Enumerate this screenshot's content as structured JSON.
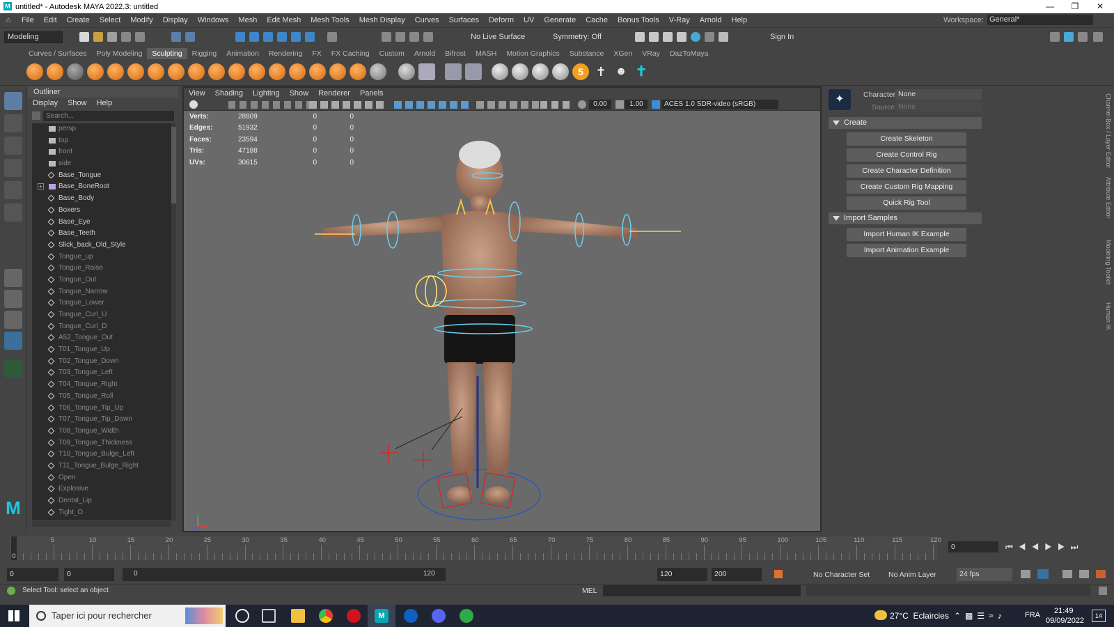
{
  "window": {
    "title": "untitled* - Autodesk MAYA 2022.3: untitled"
  },
  "menubar": [
    "File",
    "Edit",
    "Create",
    "Select",
    "Modify",
    "Display",
    "Windows",
    "Mesh",
    "Edit Mesh",
    "Mesh Tools",
    "Mesh Display",
    "Curves",
    "Surfaces",
    "Deform",
    "UV",
    "Generate",
    "Cache",
    "Bonus Tools",
    "V-Ray",
    "Arnold",
    "Help"
  ],
  "workspace": {
    "label": "Workspace:",
    "value": "General*"
  },
  "statusline": {
    "mode": "Modeling",
    "live_surface": "No Live Surface",
    "symmetry": "Symmetry: Off",
    "sign_in": "Sign In"
  },
  "shelf_tabs": [
    "Curves / Surfaces",
    "Poly Modeling",
    "Sculpting",
    "Rigging",
    "Animation",
    "Rendering",
    "FX",
    "FX Caching",
    "Custom",
    "Arnold",
    "Bifrost",
    "MASH",
    "Motion Graphics",
    "Substance",
    "XGen",
    "VRay",
    "DazToMaya"
  ],
  "shelf_active": "Sculpting",
  "outliner": {
    "title": "Outliner",
    "menu": [
      "Display",
      "Show",
      "Help"
    ],
    "search_placeholder": "Search...",
    "items": [
      {
        "name": "persp",
        "type": "camera",
        "dim": true
      },
      {
        "name": "top",
        "type": "camera",
        "dim": true
      },
      {
        "name": "front",
        "type": "camera",
        "dim": true
      },
      {
        "name": "side",
        "type": "camera",
        "dim": true
      },
      {
        "name": "Base_Tongue",
        "type": "mesh",
        "dim": false
      },
      {
        "name": "Base_BoneRoot",
        "type": "joint",
        "dim": false,
        "expandable": true
      },
      {
        "name": "Base_Body",
        "type": "mesh",
        "dim": false
      },
      {
        "name": "Boxers",
        "type": "mesh",
        "dim": false
      },
      {
        "name": "Base_Eye",
        "type": "mesh",
        "dim": false
      },
      {
        "name": "Base_Teeth",
        "type": "mesh",
        "dim": false
      },
      {
        "name": "Slick_back_Old_Style",
        "type": "mesh",
        "dim": false
      },
      {
        "name": "Tongue_up",
        "type": "mesh",
        "dim": true
      },
      {
        "name": "Tongue_Raise",
        "type": "mesh",
        "dim": true
      },
      {
        "name": "Tongue_Out",
        "type": "mesh",
        "dim": true
      },
      {
        "name": "Tongue_Narrow",
        "type": "mesh",
        "dim": true
      },
      {
        "name": "Tongue_Lower",
        "type": "mesh",
        "dim": true
      },
      {
        "name": "Tongue_Curl_U",
        "type": "mesh",
        "dim": true
      },
      {
        "name": "Tongue_Curl_D",
        "type": "mesh",
        "dim": true
      },
      {
        "name": "A52_Tongue_Out",
        "type": "mesh",
        "dim": true
      },
      {
        "name": "T01_Tongue_Up",
        "type": "mesh",
        "dim": true
      },
      {
        "name": "T02_Tongue_Down",
        "type": "mesh",
        "dim": true
      },
      {
        "name": "T03_Tongue_Left",
        "type": "mesh",
        "dim": true
      },
      {
        "name": "T04_Tongue_Right",
        "type": "mesh",
        "dim": true
      },
      {
        "name": "T05_Tongue_Roll",
        "type": "mesh",
        "dim": true
      },
      {
        "name": "T06_Tongue_Tip_Up",
        "type": "mesh",
        "dim": true
      },
      {
        "name": "T07_Tongue_Tip_Down",
        "type": "mesh",
        "dim": true
      },
      {
        "name": "T08_Tongue_Width",
        "type": "mesh",
        "dim": true
      },
      {
        "name": "T09_Tongue_Thickness",
        "type": "mesh",
        "dim": true
      },
      {
        "name": "T10_Tongue_Bulge_Left",
        "type": "mesh",
        "dim": true
      },
      {
        "name": "T11_Tongue_Bulge_Right",
        "type": "mesh",
        "dim": true
      },
      {
        "name": "Open",
        "type": "mesh",
        "dim": true
      },
      {
        "name": "Explosive",
        "type": "mesh",
        "dim": true
      },
      {
        "name": "Dental_Lip",
        "type": "mesh",
        "dim": true
      },
      {
        "name": "Tight_O",
        "type": "mesh",
        "dim": true
      }
    ]
  },
  "viewport": {
    "menu": [
      "View",
      "Shading",
      "Lighting",
      "Show",
      "Renderer",
      "Panels"
    ],
    "exposure": "0.00",
    "gamma": "1.00",
    "colorspace": "ACES 1.0 SDR-video (sRGB)",
    "hud": [
      {
        "label": "Verts:",
        "v": "28809",
        "a": "0",
        "b": "0"
      },
      {
        "label": "Edges:",
        "v": "51932",
        "a": "0",
        "b": "0"
      },
      {
        "label": "Faces:",
        "v": "23594",
        "a": "0",
        "b": "0"
      },
      {
        "label": "Tris:",
        "v": "47188",
        "a": "0",
        "b": "0"
      },
      {
        "label": "UVs:",
        "v": "30615",
        "a": "0",
        "b": "0"
      }
    ]
  },
  "humanik": {
    "character_label": "Character:",
    "character_value": "None",
    "source_label": "Source:",
    "source_value": "None",
    "create_section": "Create",
    "create_buttons": [
      "Create Skeleton",
      "Create Control Rig",
      "Create Character Definition",
      "Create Custom Rig Mapping",
      "Quick Rig Tool"
    ],
    "import_section": "Import Samples",
    "import_buttons": [
      "Import Human IK Example",
      "Import Animation Example"
    ]
  },
  "side_tabs": [
    "Channel Box / Layer Editor",
    "Attribute Editor",
    "Modeling Toolkit",
    "Human IK"
  ],
  "timeline": {
    "ticks": [
      "5",
      "10",
      "15",
      "20",
      "25",
      "30",
      "35",
      "40",
      "45",
      "50",
      "55",
      "60",
      "65",
      "70",
      "75",
      "80",
      "85",
      "90",
      "95",
      "100",
      "105",
      "110",
      "115",
      "120"
    ],
    "start": "0",
    "current_frame": "0"
  },
  "range": {
    "start": "0",
    "anim_start": "0",
    "slider_start": "0",
    "slider_end": "120",
    "end": "120",
    "anim_end": "200",
    "character_set": "No Character Set",
    "anim_layer": "No Anim Layer",
    "fps": "24 fps"
  },
  "helpline": {
    "text": "Select Tool: select an object",
    "mel": "MEL"
  },
  "taskbar": {
    "search": "Taper ici pour rechercher",
    "weather": "27°C  Eclaircies",
    "lang": "FRA",
    "time": "21:49",
    "date": "09/09/2022",
    "notif": "14"
  },
  "colors": {
    "maya_teal": "#0aa5b3",
    "active_tab": "#5d5d5d",
    "viewport_bg": "#6a6a6a"
  }
}
